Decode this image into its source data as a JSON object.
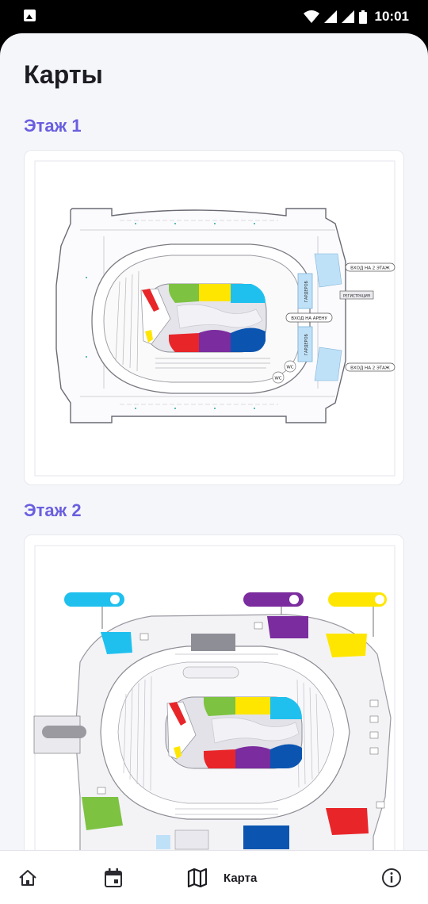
{
  "status_bar": {
    "time": "10:01"
  },
  "page": {
    "title": "Карты"
  },
  "floors": [
    {
      "title": "Этаж 1",
      "labels": {
        "entrance_top": "ВХОД НА 2 ЭТАЖ",
        "registration": "РЕГИСТРАЦИЯ",
        "arena_entrance": "ВХОД НА АРЕНУ",
        "entrance_bottom": "ВХОД НА 2 ЭТАЖ",
        "wardrobe_top": "ГАРДЕРОБ",
        "wardrobe_bottom": "ГАРДЕРОБ",
        "wc_1": "WC",
        "wc_2": "WC"
      }
    },
    {
      "title": "Этаж 2"
    }
  ],
  "colors": {
    "accent": "#6a5fe0",
    "zone_green": "#7dc241",
    "zone_yellow": "#ffe600",
    "zone_cyan": "#1fc0ee",
    "zone_red": "#e8262a",
    "zone_purple": "#7b2c9e",
    "zone_blue": "#0b55b0",
    "wardrobe_blue": "#bfe1f7"
  },
  "bottom_nav": {
    "items": [
      {
        "icon": "home-icon",
        "label": ""
      },
      {
        "icon": "calendar-icon",
        "label": ""
      },
      {
        "icon": "map-icon",
        "label": "Карта",
        "active": true
      },
      {
        "icon": "info-icon",
        "label": ""
      }
    ]
  }
}
